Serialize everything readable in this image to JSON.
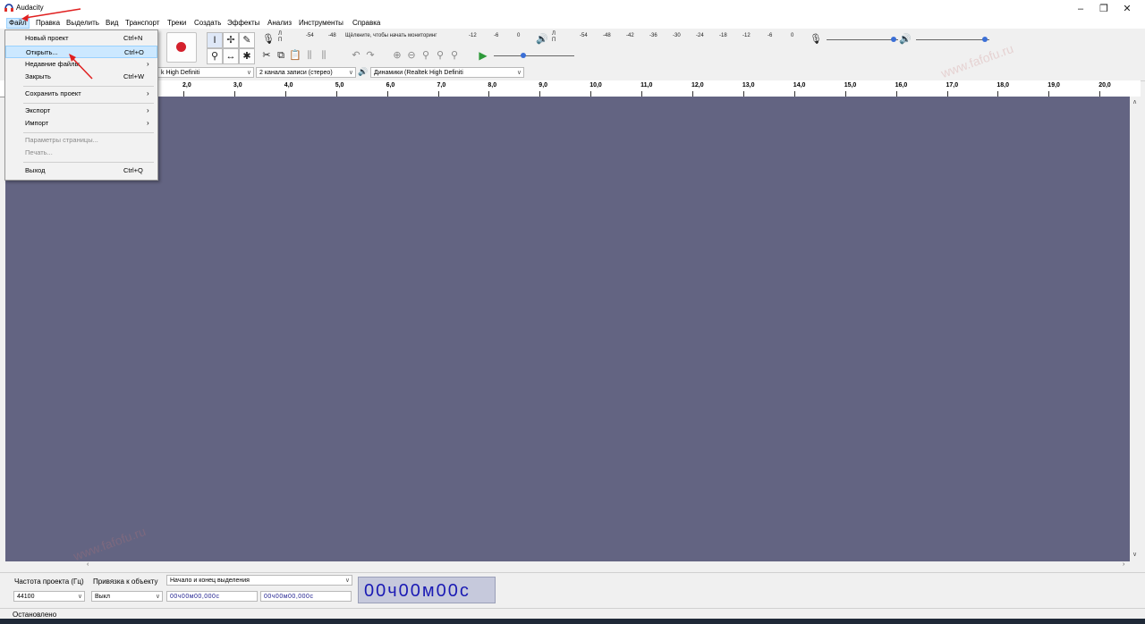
{
  "window": {
    "title": "Audacity",
    "min": "–",
    "max": "❐",
    "close": "✕"
  },
  "menu": [
    "Файл",
    "Правка",
    "Выделить",
    "Вид",
    "Транспорт",
    "Треки",
    "Создать",
    "Эффекты",
    "Анализ",
    "Инструменты",
    "Справка"
  ],
  "file_menu": [
    {
      "label": "Новый проект",
      "shortcut": "Ctrl+N"
    },
    {
      "label": "Открыть...",
      "shortcut": "Ctrl+O"
    },
    {
      "label": "Недавние файлы",
      "shortcut": "›"
    },
    {
      "label": "Закрыть",
      "shortcut": "Ctrl+W"
    },
    {
      "label": "Сохранить проект",
      "shortcut": "›"
    },
    {
      "label": "Экспорт",
      "shortcut": "›"
    },
    {
      "label": "Импорт",
      "shortcut": "›"
    },
    {
      "label": "Параметры страницы...",
      "shortcut": ""
    },
    {
      "label": "Печать...",
      "shortcut": ""
    },
    {
      "label": "Выход",
      "shortcut": "Ctrl+Q"
    }
  ],
  "meter": {
    "rec_hint": "Щёлкните, чтобы начать мониторинг",
    "rec_left": "-54",
    "rec_left2": "-48",
    "rec_right": [
      "-12",
      "-6",
      "0"
    ],
    "play_scale": [
      "-54",
      "-48",
      "-42",
      "-36",
      "-30",
      "-24",
      "-18",
      "-12",
      "-6",
      "0"
    ],
    "channel_top": "Л",
    "channel_bottom": "П"
  },
  "devices": {
    "rec_device": "k High Definiti",
    "channels": "2 канала записи (стерео)",
    "playback": "Динамики (Realtek High Definiti"
  },
  "ruler": [
    "2,0",
    "3,0",
    "4,0",
    "5,0",
    "6,0",
    "7,0",
    "8,0",
    "9,0",
    "10,0",
    "11,0",
    "12,0",
    "13,0",
    "14,0",
    "15,0",
    "16,0",
    "17,0",
    "18,0",
    "19,0",
    "20,0"
  ],
  "selection": {
    "rate_label": "Частота проекта (Гц)",
    "rate_value": "44100",
    "snap_label": "Привязка к объекту",
    "snap_value": "Выкл",
    "sel_mode": "Начало и конец выделения",
    "start": "00ч00м00,000с",
    "end": "00ч00м00,000с",
    "big": "00ч00м00с"
  },
  "status": "Остановлено",
  "watermark": "www.fafofu.ru"
}
